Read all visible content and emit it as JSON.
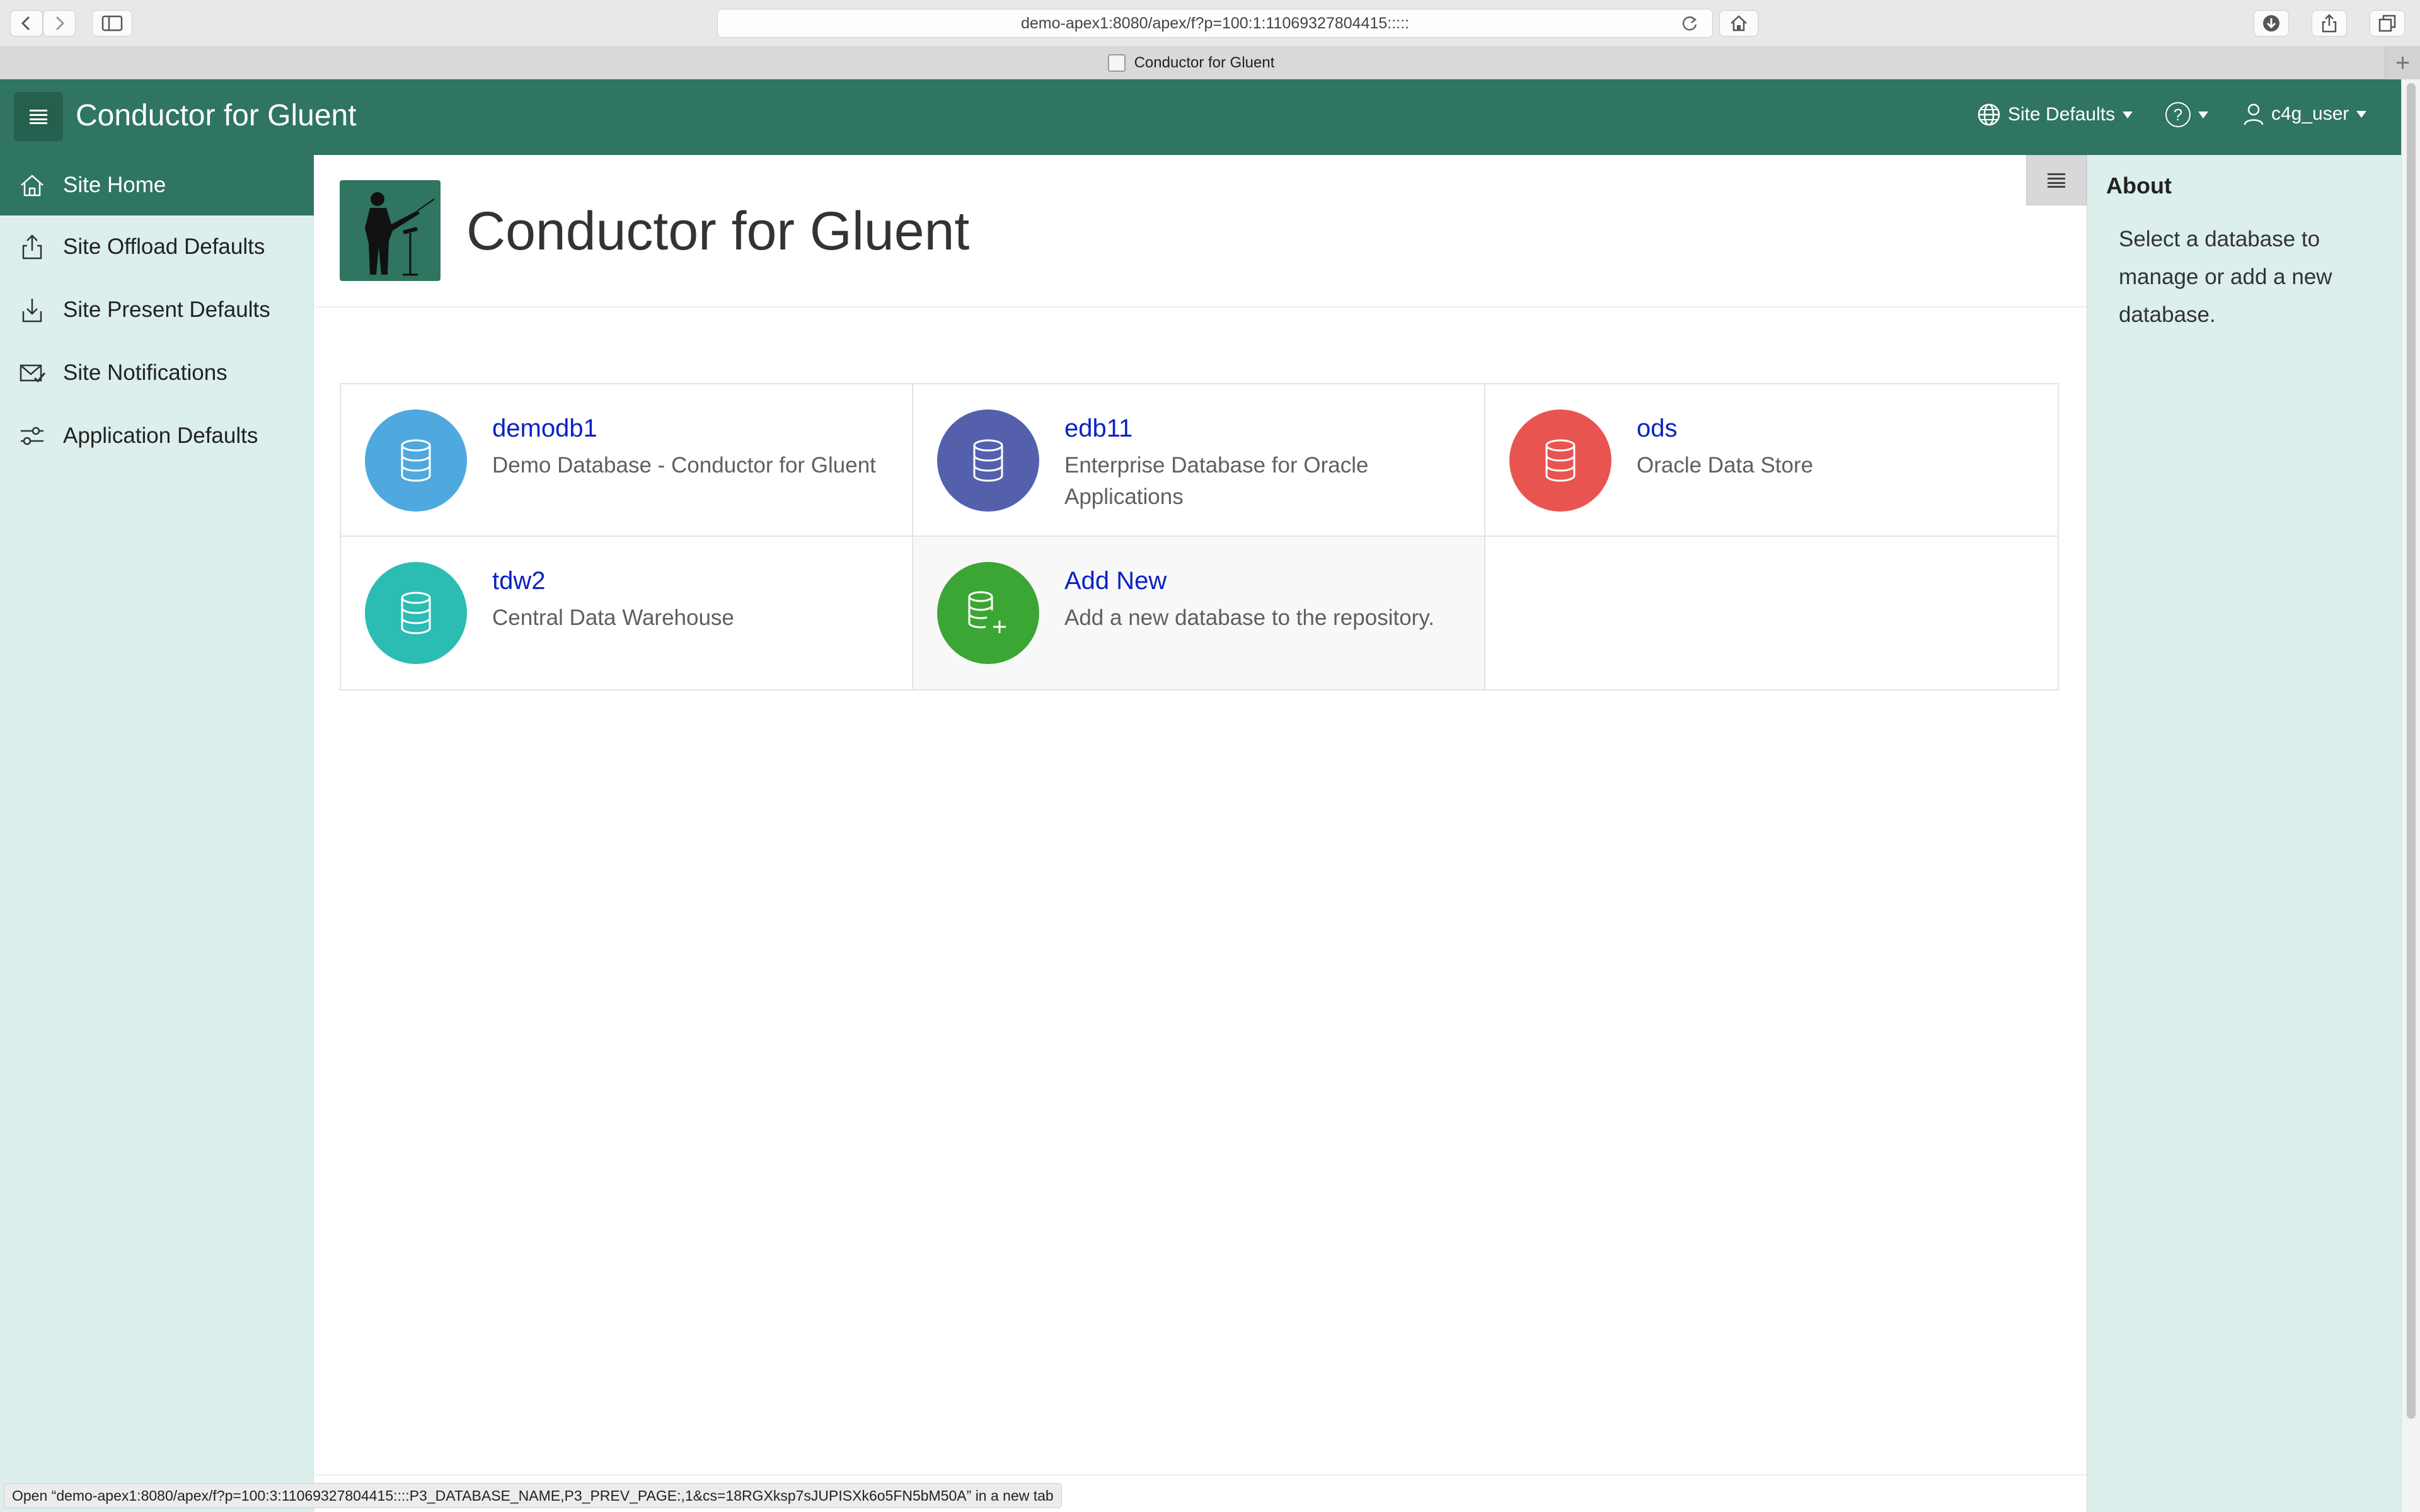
{
  "browser": {
    "url": "demo-apex1:8080/apex/f?p=100:1:11069327804415:::::",
    "tab_title": "Conductor for Gluent",
    "new_tab_glyph": "+"
  },
  "header": {
    "app_title": "Conductor for Gluent",
    "site_defaults_label": "Site Defaults",
    "help_label": "?",
    "user_label": "c4g_user"
  },
  "nav": {
    "items": [
      {
        "label": "Site Home",
        "icon": "home-icon",
        "active": true
      },
      {
        "label": "Site Offload Defaults",
        "icon": "upload-icon"
      },
      {
        "label": "Site Present Defaults",
        "icon": "download-icon"
      },
      {
        "label": "Site Notifications",
        "icon": "mail-check-icon"
      },
      {
        "label": "Application Defaults",
        "icon": "sliders-icon"
      }
    ]
  },
  "page": {
    "title": "Conductor for Gluent"
  },
  "cards": [
    {
      "title": "demodb1",
      "description": "Demo Database - Conductor for Gluent",
      "color": "#4fa9df"
    },
    {
      "title": "edb11",
      "description": "Enterprise Database for Oracle Applications",
      "color": "#5560ad"
    },
    {
      "title": "ods",
      "description": "Oracle Data Store",
      "color": "#e85550"
    },
    {
      "title": "tdw2",
      "description": "Central Data Warehouse",
      "color": "#2bbcb3"
    },
    {
      "title": "Add New",
      "description": "Add a new database to the repository.",
      "color": "#3ba634"
    }
  ],
  "about": {
    "title": "About",
    "text": "Select a database to manage or add a new database."
  },
  "status": {
    "text": "Open “demo-apex1:8080/apex/f?p=100:3:11069327804415::::P3_DATABASE_NAME,P3_PREV_PAGE:,1&cs=18RGXksp7sJUPISXk6o5FN5bM50A” in a new tab"
  },
  "colors": {
    "header_bg": "#2f7561",
    "nav_bg": "#dcefec",
    "link": "#0a22c4"
  }
}
